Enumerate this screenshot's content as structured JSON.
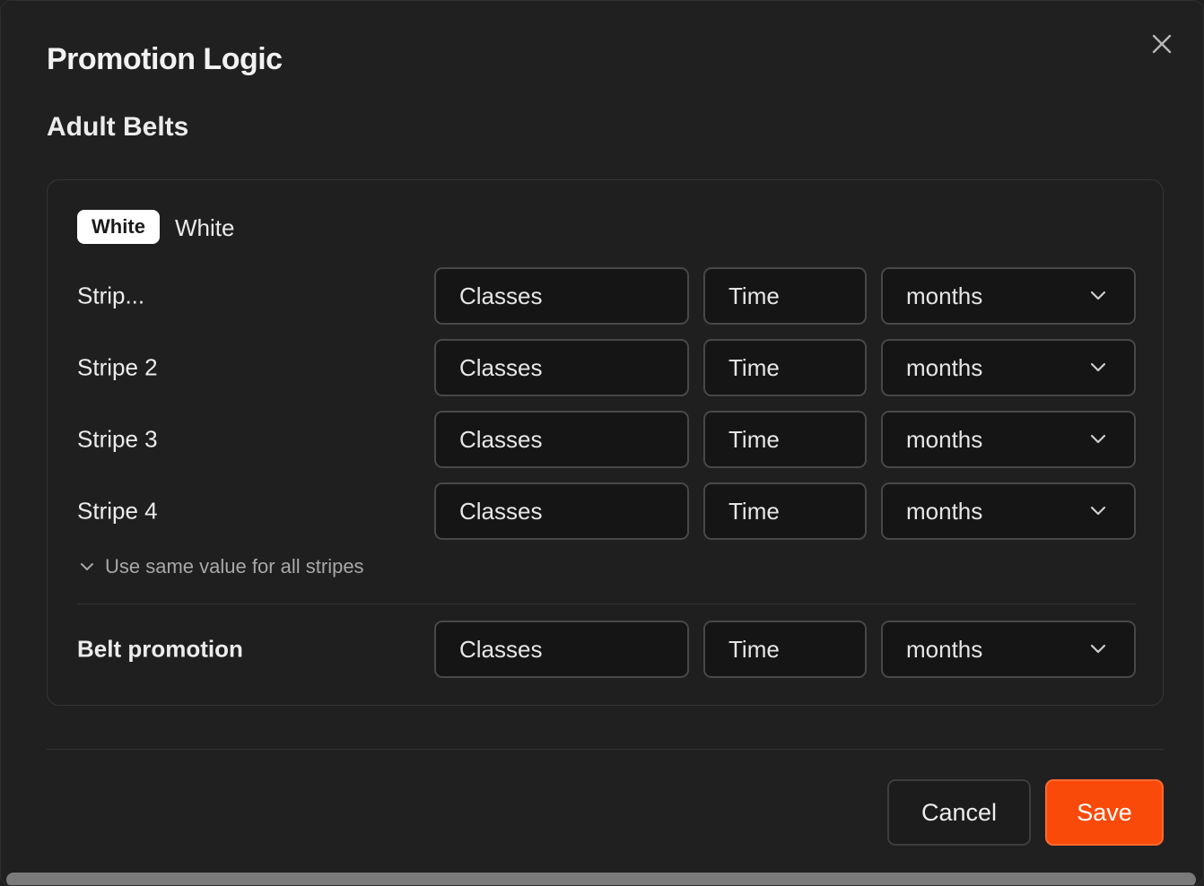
{
  "dialog": {
    "title": "Promotion Logic",
    "section_title": "Adult Belts",
    "close_icon": "close-icon"
  },
  "belt": {
    "badge_label": "White",
    "name": "White",
    "badge_color": "#ffffff"
  },
  "stripes": [
    {
      "label": "Strip...",
      "classes_placeholder": "Classes",
      "time_placeholder": "Time",
      "unit": "months"
    },
    {
      "label": "Stripe 2",
      "classes_placeholder": "Classes",
      "time_placeholder": "Time",
      "unit": "months"
    },
    {
      "label": "Stripe 3",
      "classes_placeholder": "Classes",
      "time_placeholder": "Time",
      "unit": "months"
    },
    {
      "label": "Stripe 4",
      "classes_placeholder": "Classes",
      "time_placeholder": "Time",
      "unit": "months"
    }
  ],
  "same_value_toggle": "Use same value for all stripes",
  "belt_promotion": {
    "label": "Belt promotion",
    "classes_placeholder": "Classes",
    "time_placeholder": "Time",
    "unit": "months"
  },
  "footer": {
    "cancel_label": "Cancel",
    "save_label": "Save",
    "save_color": "#fa4a0a"
  }
}
